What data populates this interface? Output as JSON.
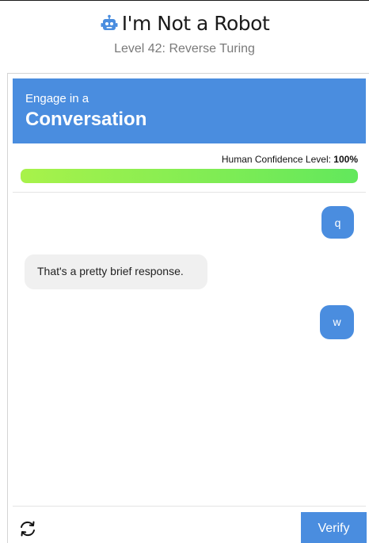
{
  "header": {
    "title": "I'm Not a Robot",
    "subtitle": "Level 42: Reverse Turing",
    "icon": "robot-icon"
  },
  "banner": {
    "line1": "Engage in a",
    "line2": "Conversation"
  },
  "confidence": {
    "label": "Human Confidence Level: ",
    "value_text": "100%",
    "value": 1.0
  },
  "chat": {
    "messages": [
      {
        "role": "user",
        "text": "q"
      },
      {
        "role": "bot",
        "text": "That's a pretty brief response."
      },
      {
        "role": "user",
        "text": "w"
      }
    ]
  },
  "footer": {
    "refresh_icon": "refresh-icon",
    "verify_label": "Verify"
  },
  "colors": {
    "accent": "#4a8ddf",
    "bar_start": "#a8f24a",
    "bar_end": "#62e85c"
  }
}
